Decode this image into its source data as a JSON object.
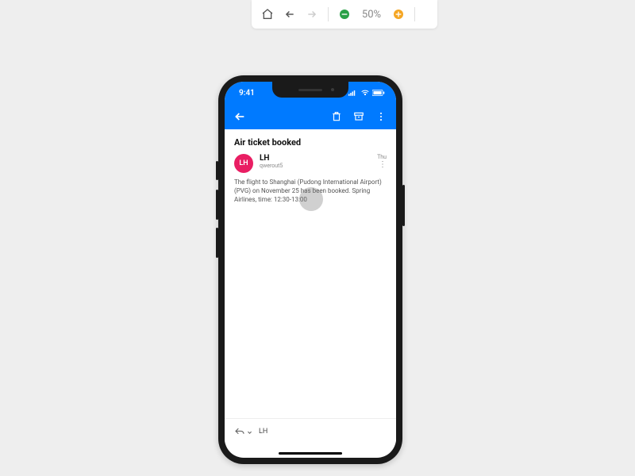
{
  "toolbar": {
    "zoom": "50%"
  },
  "status": {
    "time": "9:41"
  },
  "email": {
    "subject": "Air ticket booked",
    "avatar_initials": "LH",
    "sender_name": "LH",
    "sender_addr": "qwerout5",
    "date": "Thu",
    "body": "The flight to Shanghai (Pudong International Airport) (PVG) on November 25 has been booked. Spring Airlines, time: 12:30-13:00"
  },
  "reply": {
    "recipient": "LH"
  }
}
